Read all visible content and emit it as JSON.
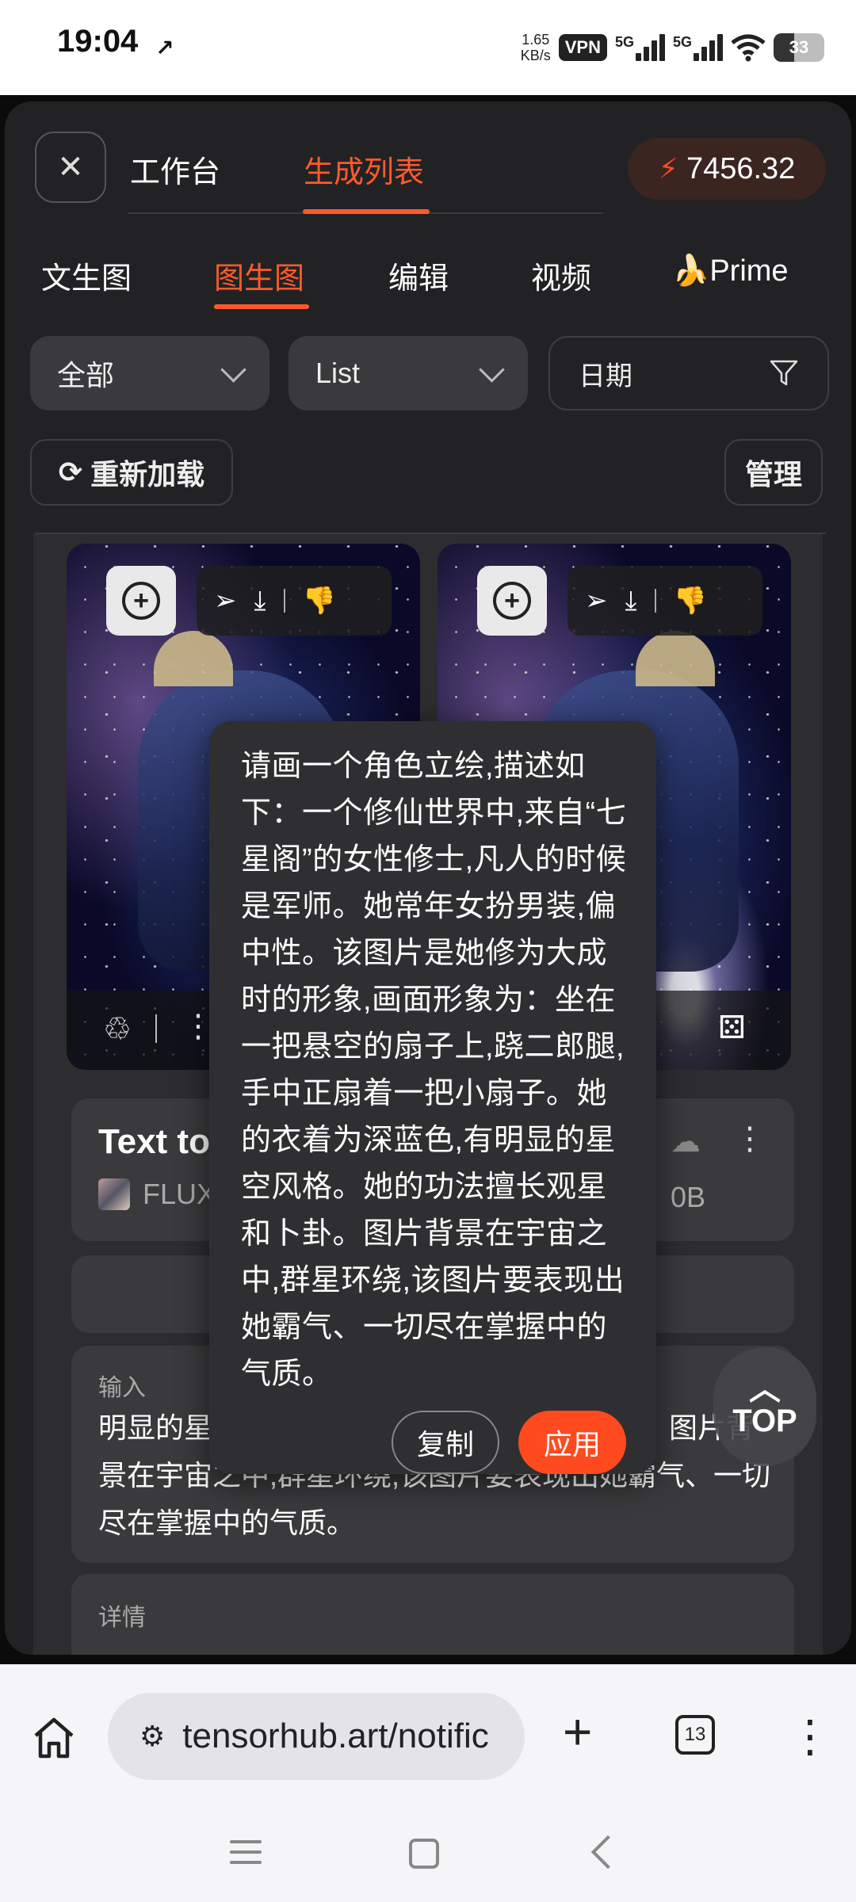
{
  "status": {
    "time": "19:04",
    "speed_value": "1.65",
    "speed_unit": "KB/s",
    "vpn": "VPN",
    "net1": "5G",
    "net2": "5G",
    "battery": "33"
  },
  "header": {
    "tabs": [
      "工作台",
      "生成列表"
    ],
    "active_tab": 1,
    "credits": "7456.32"
  },
  "categories": [
    "文生图",
    "图生图",
    "编辑",
    "视频",
    "🍌Prime"
  ],
  "filters": {
    "scope": "全部",
    "view": "List",
    "date": "日期"
  },
  "actions": {
    "reload": "重新加载",
    "manage": "管理"
  },
  "card": {
    "title": "Text to",
    "model": "FLUX",
    "model_suffix": "0B"
  },
  "input_card": {
    "label": "输入",
    "text": "明显的星空风格。她的功法擅长观星和卜卦。图片背景在宇宙之中,群星环绕,该图片要表现出她霸气、一切尽在掌握中的气质。"
  },
  "details_card": {
    "label": "详情"
  },
  "popover": {
    "text": "请画一个角色立绘,描述如下：一个修仙世界中,来自“七星阁”的女性修士,凡人的时候是军师。她常年女扮男装,偏中性。该图片是她修为大成时的形象,画面形象为：坐在一把悬空的扇子上,跷二郎腿,手中正扇着一把小扇子。她的衣着为深蓝色,有明显的星空风格。她的功法擅长观星和卜卦。图片背景在宇宙之中,群星环绕,该图片要表现出她霸气、一切尽在掌握中的气质。",
    "copy": "复制",
    "apply": "应用"
  },
  "top_button": "TOP",
  "browser": {
    "url": "tensorhub.art/notific",
    "tab_count": "13"
  },
  "colors": {
    "accent": "#ff5a2c",
    "panel": "#222224",
    "card": "#3a3a3c"
  }
}
